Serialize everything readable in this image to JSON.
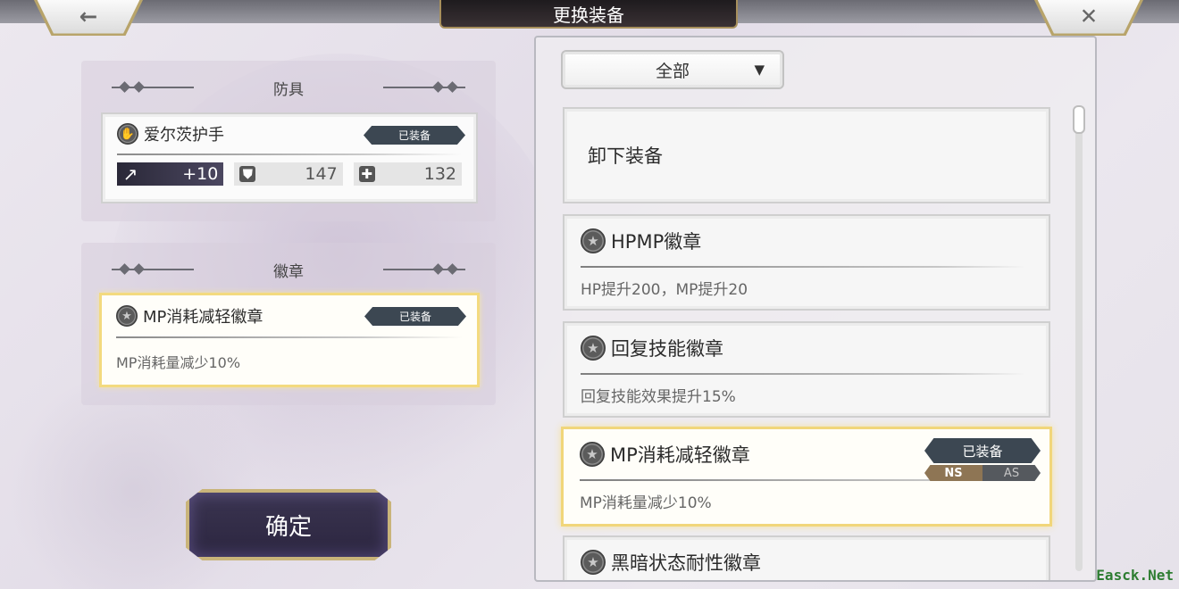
{
  "header": {
    "title": "更换装备",
    "back_icon": "←",
    "close_icon": "✕"
  },
  "armor_section": {
    "heading": "防具",
    "item": {
      "name": "爱尔茨护手",
      "tag": "已装备",
      "stats": [
        {
          "icon": "↗",
          "value": "+10"
        },
        {
          "icon": "⛊",
          "value": "147"
        },
        {
          "icon": "✚",
          "value": "132"
        }
      ]
    }
  },
  "emblem_section": {
    "heading": "徽章",
    "item": {
      "name": "MP消耗减轻徽章",
      "tag": "已装备",
      "desc": "MP消耗量减少10%"
    }
  },
  "confirm_label": "确定",
  "filter": {
    "selected": "全部",
    "arrow": "▼"
  },
  "list": {
    "unequip_label": "卸下装备",
    "items": [
      {
        "name": "HPMP徽章",
        "desc": "HP提升200，MP提升20"
      },
      {
        "name": "回复技能徽章",
        "desc": "回复技能效果提升15%"
      },
      {
        "name": "MP消耗减轻徽章",
        "desc": "MP消耗量减少10%",
        "tag": "已装备",
        "mode_ns": "NS",
        "mode_as": "AS"
      },
      {
        "name": "黑暗状态耐性徽章",
        "desc": ""
      }
    ]
  },
  "badge_glyph": "★",
  "watermark": "Easck.Net"
}
